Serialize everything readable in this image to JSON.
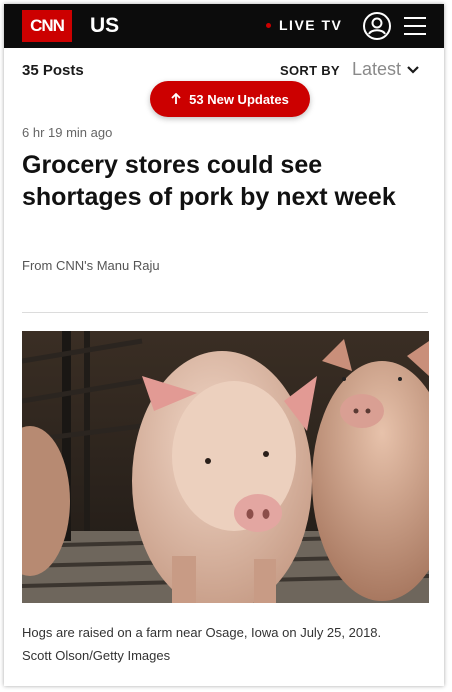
{
  "header": {
    "logo_text": "CNN",
    "region": "US",
    "live_label": "LIVE TV",
    "icons": [
      "user-icon",
      "menu-icon"
    ],
    "brand_color": "#cc0000"
  },
  "feed": {
    "posts_count": "35 Posts",
    "sort_label": "SORT BY",
    "sort_value": "Latest",
    "updates_button": "53 New Updates"
  },
  "article": {
    "timestamp": "6 hr 19 min ago",
    "headline": "Grocery stores could see shortages of pork by next week",
    "byline": "From CNN's Manu Raju",
    "image_caption": "Hogs are raised on a farm near Osage, Iowa on July 25, 2018.",
    "image_credit": "Scott Olson/Getty Images"
  }
}
